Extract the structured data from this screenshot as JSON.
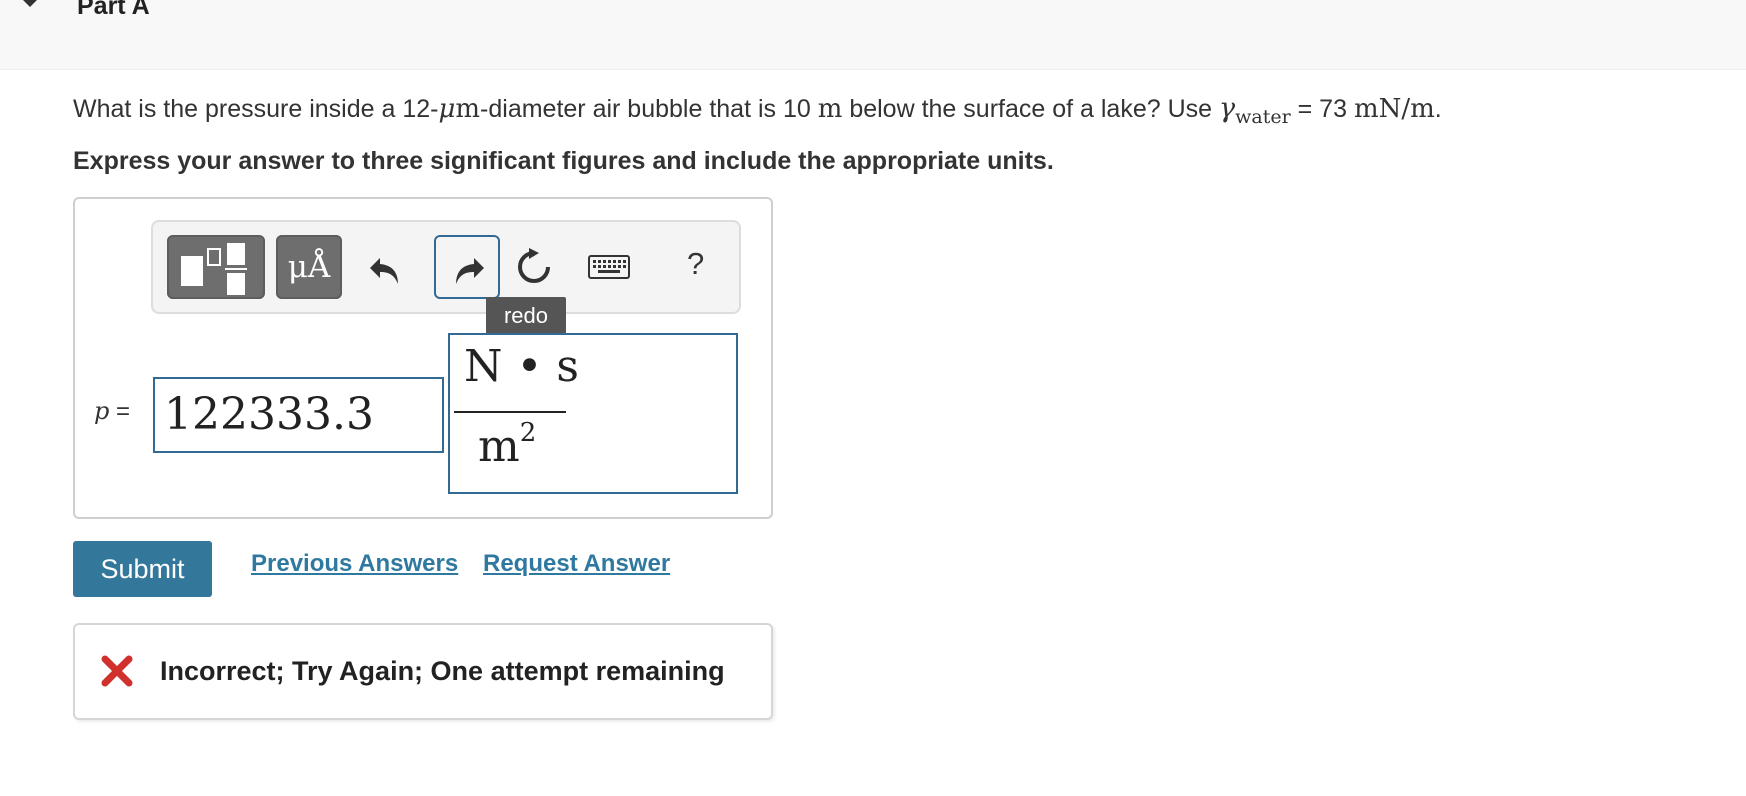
{
  "part": {
    "title": "Part A"
  },
  "question": {
    "text_1": "What is the pressure inside a 12-",
    "mu": "μ",
    "m_unit": "m",
    "text_2": "-diameter air bubble that is 10 ",
    "depth_unit": "m",
    "text_3": " below the surface of a lake? Use ",
    "gamma": "γ",
    "gamma_sub": "water",
    "text_4": " = 73 ",
    "tension_unit": "mN/m",
    "text_5": ".",
    "instruction": "Express your answer to three significant figures and include the appropriate units."
  },
  "toolbar": {
    "templates_icon": "templates-icon",
    "units_label": "μÅ",
    "undo_icon": "undo-icon",
    "redo_icon": "redo-icon",
    "reset_icon": "reset-icon",
    "keyboard_icon": "keyboard-icon",
    "help_label": "?",
    "tooltip": "redo"
  },
  "answer": {
    "variable": "p",
    "equals": "=",
    "value": "122333.3",
    "unit_numerator": "N • s",
    "unit_denominator": "m",
    "unit_exponent": "2"
  },
  "actions": {
    "submit": "Submit",
    "previous_answers": "Previous Answers",
    "request_answer": "Request Answer"
  },
  "feedback": {
    "icon": "x-icon",
    "text": "Incorrect; Try Again; One attempt remaining"
  },
  "colors": {
    "accent": "#33779a",
    "link": "#2f79a0",
    "error": "#d0312d",
    "toolbar_button": "#6e6e6e"
  }
}
